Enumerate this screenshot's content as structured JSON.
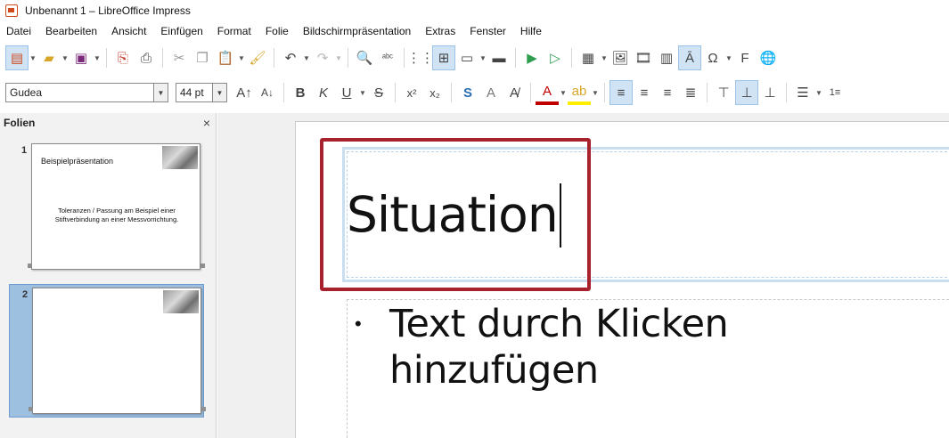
{
  "window": {
    "title": "Unbenannt 1 – LibreOffice Impress"
  },
  "menubar": {
    "items": [
      "Datei",
      "Bearbeiten",
      "Ansicht",
      "Einfügen",
      "Format",
      "Folie",
      "Bildschirmpräsentation",
      "Extras",
      "Fenster",
      "Hilfe"
    ]
  },
  "format_toolbar": {
    "font_name": "Gudea",
    "font_size": "44 pt"
  },
  "slide_panel": {
    "title": "Folien",
    "close": "×",
    "slides": [
      {
        "number": "1",
        "title": "Beispielpräsentation",
        "body": "Toleranzen / Passung am Beispiel einer Stiftverbindung an einer Messvorrichtung."
      },
      {
        "number": "2",
        "title": "",
        "body": ""
      }
    ]
  },
  "editor": {
    "title_text": "Situation",
    "content_placeholder": "Text durch Klicken hinzufügen",
    "bullet": "•"
  },
  "colors": {
    "highlight": "#a8222e",
    "selected_slide": "#9dbfe0",
    "font_color_bar": "#c00000",
    "highlight_color_bar": "#ffee00"
  }
}
